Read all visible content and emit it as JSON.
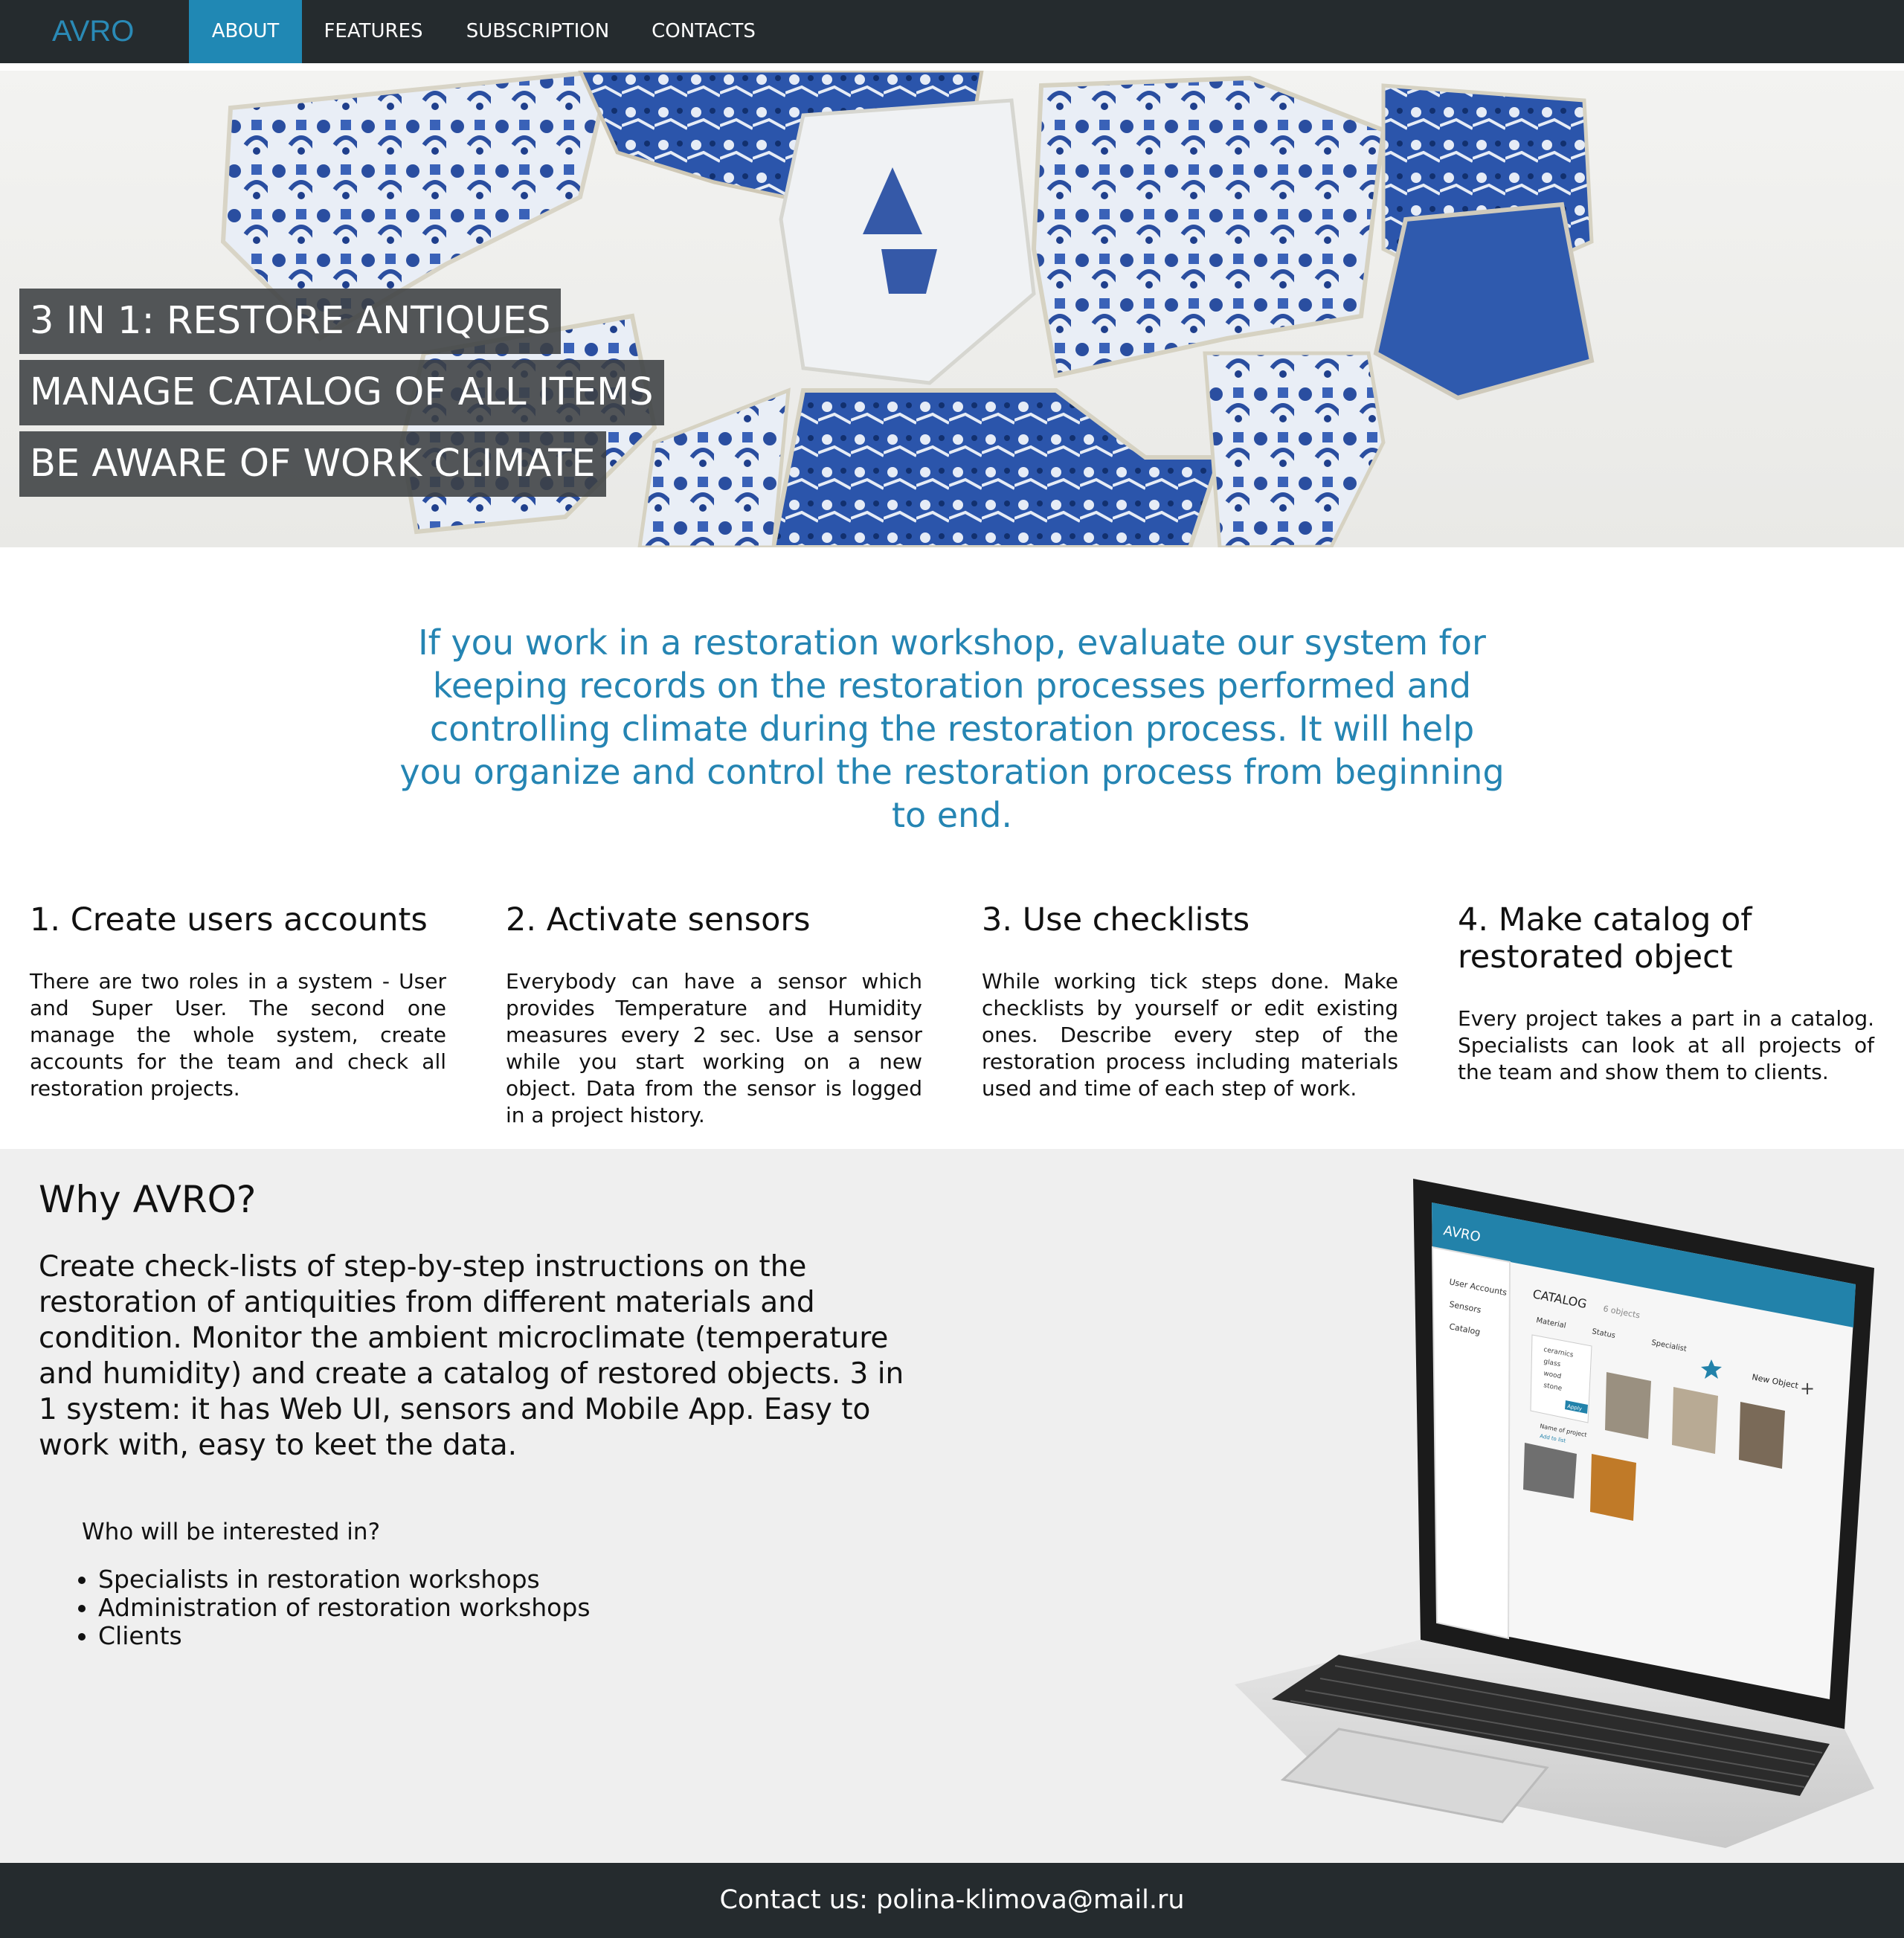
{
  "nav": {
    "logo": "AVRO",
    "items": [
      {
        "label": "ABOUT",
        "active": true
      },
      {
        "label": "FEATURES",
        "active": false
      },
      {
        "label": "SUBSCRIPTION",
        "active": false
      },
      {
        "label": "CONTACTS",
        "active": false
      }
    ]
  },
  "hero": {
    "lines": [
      "3 IN 1: RESTORE ANTIQUES",
      "MANAGE CATALOG OF ALL ITEMS",
      "BE AWARE OF WORK CLIMATE"
    ]
  },
  "intro": "If you work in a restoration workshop, evaluate our system for keeping records on the restoration processes performed and controlling climate during the restoration process. It will help you organize and control the restoration process from beginning to end.",
  "steps": [
    {
      "title": "1. Create users accounts",
      "text": "There are two roles in a system - User and Super User. The second one manage the whole system, create accounts for the team and check all restoration projects."
    },
    {
      "title": "2. Activate sensors",
      "text": "Everybody can have a sensor which provides Temperature and Humidity measures every 2 sec. Use a sensor while you start working on a new object. Data from the sensor is logged in a project history."
    },
    {
      "title": "3. Use checklists",
      "text": "While working tick steps done. Make checklists by yourself or edit existing ones. Describe every step of the restoration process including materials used and time of each step of work."
    },
    {
      "title": "4. Make catalog of restorated object",
      "text": "Every project takes a part in a catalog. Specialists can look at all projects of the team and show them to clients."
    }
  ],
  "why": {
    "title": "Why AVRO?",
    "text": "Create check-lists of step-by-step instructions on the restoration of antiquities from different materials and condition. Monitor the ambient microclimate (temperature and humidity) and create a catalog of restored objects. 3 in 1 system: it has Web UI, sensors and Mobile App. Easy to work with, easy to keet the data.",
    "who_title": "Who will be interested in?",
    "audience": [
      "Specialists in restoration workshops",
      "Administration of restoration workshops",
      "Clients"
    ]
  },
  "laptop": {
    "logo": "AVRO",
    "menu": [
      "User Accounts",
      "Sensors",
      "Catalog"
    ],
    "catalog_title": "CATALOG",
    "catalog_count": "6 objects",
    "filters": [
      "Material",
      "Status",
      "Specialist"
    ],
    "materials": [
      "ceramics",
      "glass",
      "wood",
      "stone"
    ],
    "apply": "Apply",
    "new_object": "New Object",
    "card_name": "Name of project",
    "card_add": "Add to list"
  },
  "footer": {
    "contact": "Contact us: polina-klimova@mail.ru"
  }
}
